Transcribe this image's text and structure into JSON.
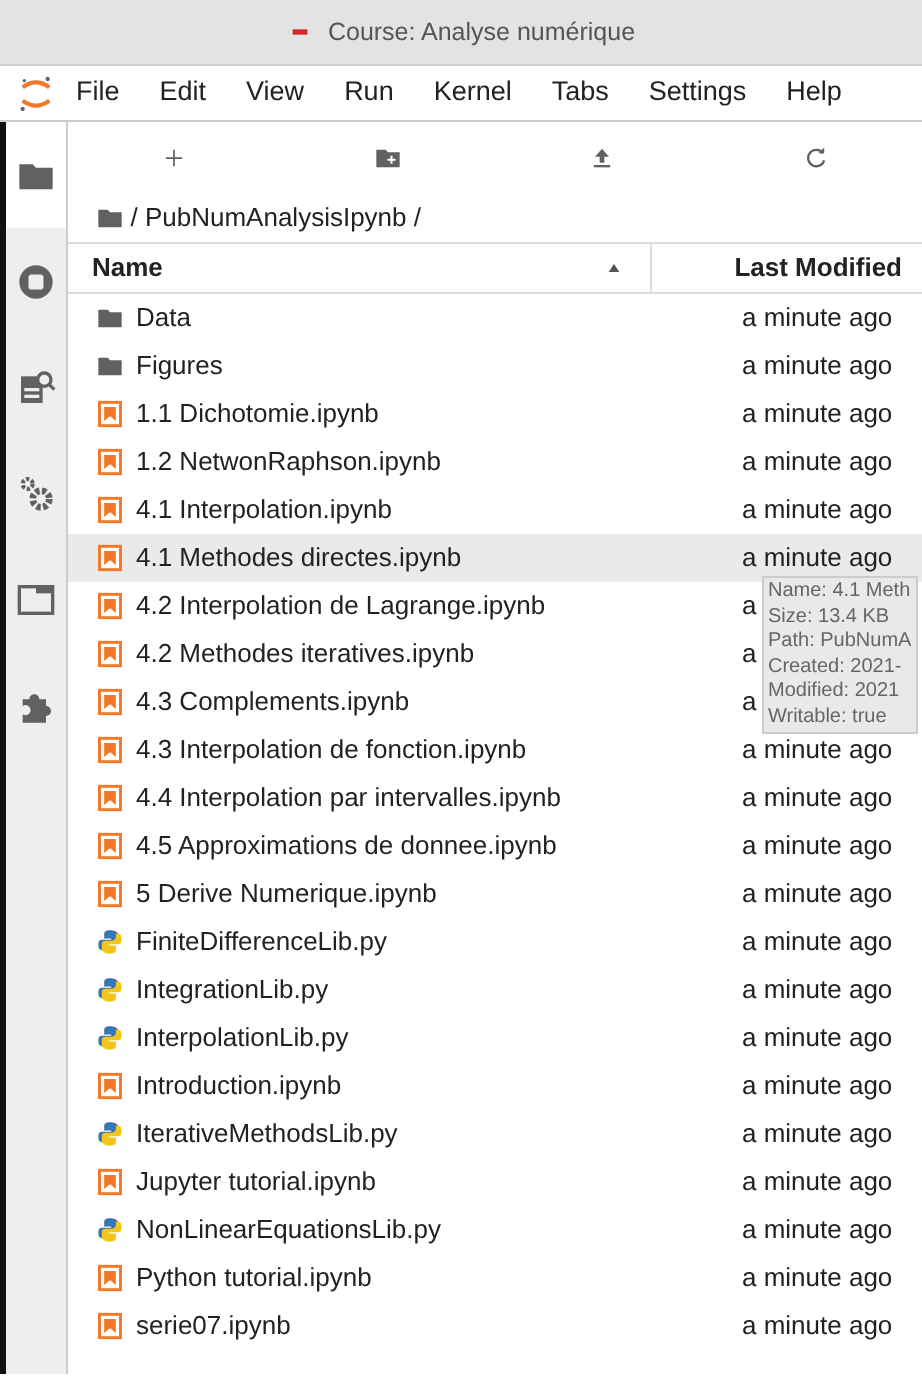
{
  "window": {
    "title": "Course: Analyse numérique"
  },
  "menu": [
    "File",
    "Edit",
    "View",
    "Run",
    "Kernel",
    "Tabs",
    "Settings",
    "Help"
  ],
  "sidebar": {
    "items": [
      {
        "kind": "folder",
        "selected": true
      },
      {
        "kind": "running",
        "selected": false
      },
      {
        "kind": "inspector",
        "selected": false
      },
      {
        "kind": "gears",
        "selected": false
      },
      {
        "kind": "window",
        "selected": false
      },
      {
        "kind": "extension",
        "selected": false
      }
    ]
  },
  "breadcrumb": "/ PubNumAnalysisIpynb /",
  "columns": [
    "Name",
    "Last Modified"
  ],
  "files": [
    {
      "kind": "folder",
      "name": "Data",
      "modified": "a minute ago",
      "selected": false
    },
    {
      "kind": "folder",
      "name": "Figures",
      "modified": "a minute ago",
      "selected": false
    },
    {
      "kind": "notebook",
      "name": "1.1 Dichotomie.ipynb",
      "modified": "a minute ago",
      "selected": false
    },
    {
      "kind": "notebook",
      "name": "1.2 NetwonRaphson.ipynb",
      "modified": "a minute ago",
      "selected": false
    },
    {
      "kind": "notebook",
      "name": "4.1 Interpolation.ipynb",
      "modified": "a minute ago",
      "selected": false
    },
    {
      "kind": "notebook",
      "name": "4.1 Methodes directes.ipynb",
      "modified": "a minute ago",
      "selected": true
    },
    {
      "kind": "notebook",
      "name": "4.2 Interpolation de Lagrange.ipynb",
      "modified": "a",
      "selected": false
    },
    {
      "kind": "notebook",
      "name": "4.2 Methodes iteratives.ipynb",
      "modified": "a",
      "selected": false
    },
    {
      "kind": "notebook",
      "name": "4.3 Complements.ipynb",
      "modified": "a",
      "selected": false
    },
    {
      "kind": "notebook",
      "name": "4.3 Interpolation de fonction.ipynb",
      "modified": "a minute ago",
      "selected": false
    },
    {
      "kind": "notebook",
      "name": "4.4 Interpolation par intervalles.ipynb",
      "modified": "a minute ago",
      "selected": false
    },
    {
      "kind": "notebook",
      "name": "4.5 Approximations de donnee.ipynb",
      "modified": "a minute ago",
      "selected": false
    },
    {
      "kind": "notebook",
      "name": "5 Derive Numerique.ipynb",
      "modified": "a minute ago",
      "selected": false
    },
    {
      "kind": "python",
      "name": "FiniteDifferenceLib.py",
      "modified": "a minute ago",
      "selected": false
    },
    {
      "kind": "python",
      "name": "IntegrationLib.py",
      "modified": "a minute ago",
      "selected": false
    },
    {
      "kind": "python",
      "name": "InterpolationLib.py",
      "modified": "a minute ago",
      "selected": false
    },
    {
      "kind": "notebook",
      "name": "Introduction.ipynb",
      "modified": "a minute ago",
      "selected": false
    },
    {
      "kind": "python",
      "name": "IterativeMethodsLib.py",
      "modified": "a minute ago",
      "selected": false
    },
    {
      "kind": "notebook",
      "name": "Jupyter tutorial.ipynb",
      "modified": "a minute ago",
      "selected": false
    },
    {
      "kind": "python",
      "name": "NonLinearEquationsLib.py",
      "modified": "a minute ago",
      "selected": false
    },
    {
      "kind": "notebook",
      "name": "Python tutorial.ipynb",
      "modified": "a minute ago",
      "selected": false
    },
    {
      "kind": "notebook",
      "name": "serie07.ipynb",
      "modified": "a minute ago",
      "selected": false
    }
  ],
  "tooltip": [
    "Name: 4.1 Meth",
    "Size: 13.4 KB",
    "Path: PubNumA",
    "Created: 2021-",
    "Modified: 2021",
    "Writable: true"
  ]
}
